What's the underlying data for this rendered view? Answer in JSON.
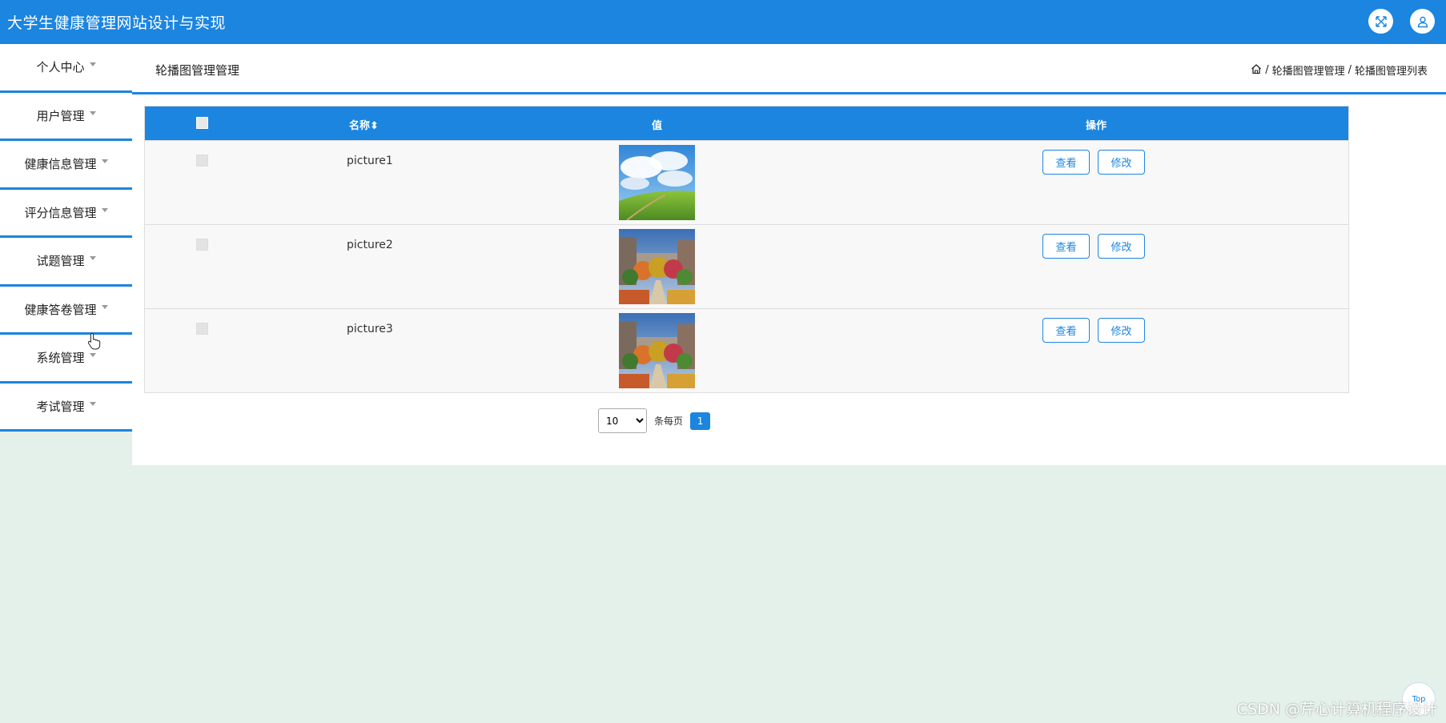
{
  "app": {
    "title": "大学生健康管理网站设计与实现"
  },
  "header_icons": {
    "expand": "fullscreen-icon",
    "user": "user-icon"
  },
  "sidebar": {
    "items": [
      {
        "label": "个人中心"
      },
      {
        "label": "用户管理"
      },
      {
        "label": "健康信息管理"
      },
      {
        "label": "评分信息管理"
      },
      {
        "label": "试题管理"
      },
      {
        "label": "健康答卷管理"
      },
      {
        "label": "系统管理"
      },
      {
        "label": "考试管理"
      }
    ]
  },
  "page": {
    "title": "轮播图管理管理",
    "breadcrumb": {
      "home_icon": "home-icon",
      "sep": "/",
      "level1": "轮播图管理管理",
      "level2": "轮播图管理列表"
    }
  },
  "table": {
    "columns": {
      "name": "名称",
      "sort_indicator": "⬍",
      "value": "值",
      "actions": "操作"
    },
    "rows": [
      {
        "name": "picture1",
        "image": "grassland-sky",
        "view": "查看",
        "edit": "修改"
      },
      {
        "name": "picture2",
        "image": "campus-autumn",
        "view": "查看",
        "edit": "修改"
      },
      {
        "name": "picture3",
        "image": "campus-autumn",
        "view": "查看",
        "edit": "修改"
      }
    ]
  },
  "pagination": {
    "page_size": "10",
    "per_page_label": "条每页",
    "current_page": "1"
  },
  "top_button": "Top",
  "watermark": "CSDN @芹心计算机程序设计",
  "colors": {
    "primary": "#1b85e0",
    "background": "#e4f0ea"
  }
}
